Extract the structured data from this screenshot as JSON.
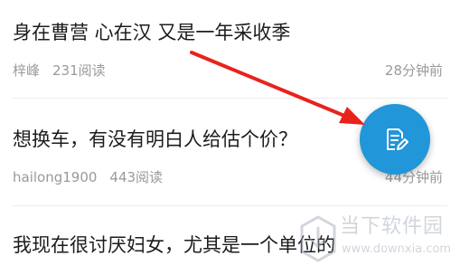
{
  "posts": [
    {
      "title": "身在曹营 心在汉 又是一年采收季",
      "author": "梓峰",
      "views": "231阅读",
      "time": "28分钟前"
    },
    {
      "title": "想换车，有没有明白人给估个价？",
      "author": "hailong1900",
      "views": "443阅读",
      "time": "44分钟前"
    },
    {
      "title": "我现在很讨厌妇女，尤其是一个单位的"
    }
  ],
  "fab": {
    "icon": "edit-post-icon",
    "color": "#2196d8"
  },
  "annotation": {
    "arrow_color": "#e8231c"
  },
  "watermark": {
    "name": "当下软件园",
    "url": "www.downxia.com"
  }
}
